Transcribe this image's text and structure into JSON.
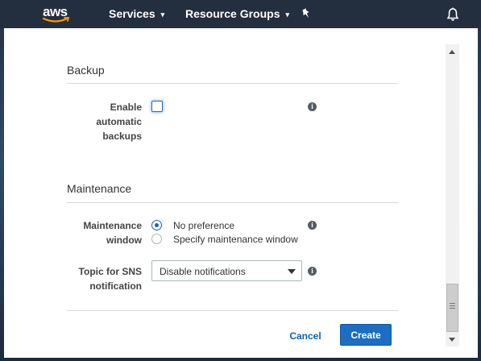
{
  "nav": {
    "logo_text": "aws",
    "services_label": "Services",
    "resource_groups_label": "Resource Groups",
    "caret": "▾"
  },
  "backup": {
    "section_title": "Backup",
    "enable_label": "Enable automatic backups",
    "enable_checked": false
  },
  "maintenance": {
    "section_title": "Maintenance",
    "window_label": "Maintenance window",
    "window_options": [
      {
        "label": "No preference",
        "selected": true
      },
      {
        "label": "Specify maintenance window",
        "selected": false
      }
    ],
    "sns_label": "Topic for SNS notification",
    "sns_value": "Disable notifications"
  },
  "info_glyph": "i",
  "footer": {
    "cancel_label": "Cancel",
    "create_label": "Create"
  },
  "colors": {
    "nav_bg": "#232f3e",
    "primary_button": "#1b6ec2",
    "link": "#0a63b8",
    "aws_smile": "#ff9900"
  }
}
